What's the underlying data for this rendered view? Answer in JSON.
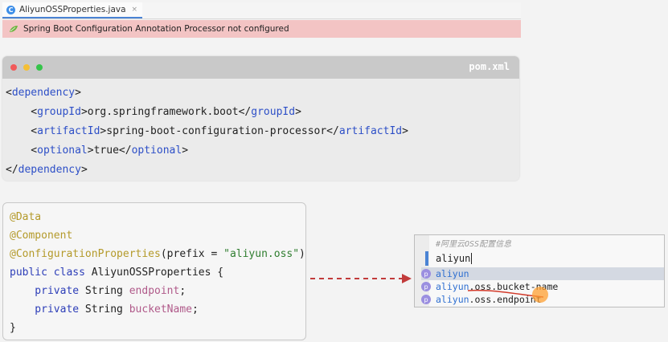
{
  "editor": {
    "tab_icon": "C",
    "tab_label": "AliyunOSSProperties.java",
    "tab_close": "×",
    "banner_text": "Spring Boot Configuration Annotation Processor not configured"
  },
  "pom": {
    "title": "pom.xml",
    "lines": [
      {
        "parts": [
          {
            "t": "<",
            "c": "plain"
          },
          {
            "t": "dependency",
            "c": "tag"
          },
          {
            "t": ">",
            "c": "plain"
          }
        ]
      },
      {
        "parts": [
          {
            "t": "    <",
            "c": "plain"
          },
          {
            "t": "groupId",
            "c": "tag"
          },
          {
            "t": ">org.springframework.boot</",
            "c": "plain"
          },
          {
            "t": "groupId",
            "c": "tag"
          },
          {
            "t": ">",
            "c": "plain"
          }
        ]
      },
      {
        "parts": [
          {
            "t": "    <",
            "c": "plain"
          },
          {
            "t": "artifactId",
            "c": "tag"
          },
          {
            "t": ">spring-boot-configuration-processor</",
            "c": "plain"
          },
          {
            "t": "artifactId",
            "c": "tag"
          },
          {
            "t": ">",
            "c": "plain"
          }
        ]
      },
      {
        "parts": [
          {
            "t": "    <",
            "c": "plain"
          },
          {
            "t": "optional",
            "c": "tag"
          },
          {
            "t": ">true</",
            "c": "plain"
          },
          {
            "t": "optional",
            "c": "tag"
          },
          {
            "t": ">",
            "c": "plain"
          }
        ]
      },
      {
        "parts": [
          {
            "t": "</",
            "c": "plain"
          },
          {
            "t": "dependency",
            "c": "tag"
          },
          {
            "t": ">",
            "c": "plain"
          }
        ]
      }
    ]
  },
  "java": {
    "lines": [
      {
        "parts": [
          {
            "t": "@Data",
            "c": "anno"
          }
        ]
      },
      {
        "parts": [
          {
            "t": "@Component",
            "c": "anno"
          }
        ]
      },
      {
        "parts": [
          {
            "t": "@ConfigurationProperties",
            "c": "anno"
          },
          {
            "t": "(prefix = ",
            "c": "plain"
          },
          {
            "t": "\"aliyun.oss\"",
            "c": "str"
          },
          {
            "t": ")",
            "c": "plain"
          }
        ]
      },
      {
        "parts": [
          {
            "t": "public class ",
            "c": "kw"
          },
          {
            "t": "AliyunOSSProperties {",
            "c": "plain"
          }
        ]
      },
      {
        "parts": [
          {
            "t": "    private ",
            "c": "kw"
          },
          {
            "t": "String ",
            "c": "plain"
          },
          {
            "t": "endpoint",
            "c": "field"
          },
          {
            "t": ";",
            "c": "plain"
          }
        ]
      },
      {
        "parts": [
          {
            "t": "    private ",
            "c": "kw"
          },
          {
            "t": "String ",
            "c": "plain"
          },
          {
            "t": "bucketName",
            "c": "field"
          },
          {
            "t": ";",
            "c": "plain"
          }
        ]
      },
      {
        "parts": [
          {
            "t": "}",
            "c": "plain"
          }
        ]
      }
    ]
  },
  "popup": {
    "comment": "#阿里云OSS配置信息",
    "input_value": "aliyun",
    "items": [
      {
        "badge": "p",
        "match": "aliyun",
        "rest": ""
      },
      {
        "badge": "p",
        "match": "aliyun",
        "rest": ".oss.bucket-name"
      },
      {
        "badge": "p",
        "match": "aliyun",
        "rest": ".oss.endpoint"
      }
    ]
  },
  "colors": {
    "banner_bg": "#f3c4c4",
    "xml_tag": "#2d4fc7",
    "annotation": "#b49a2a",
    "keyword": "#2d3eb8",
    "field": "#b05a8a",
    "arrow": "#c23b3b"
  }
}
